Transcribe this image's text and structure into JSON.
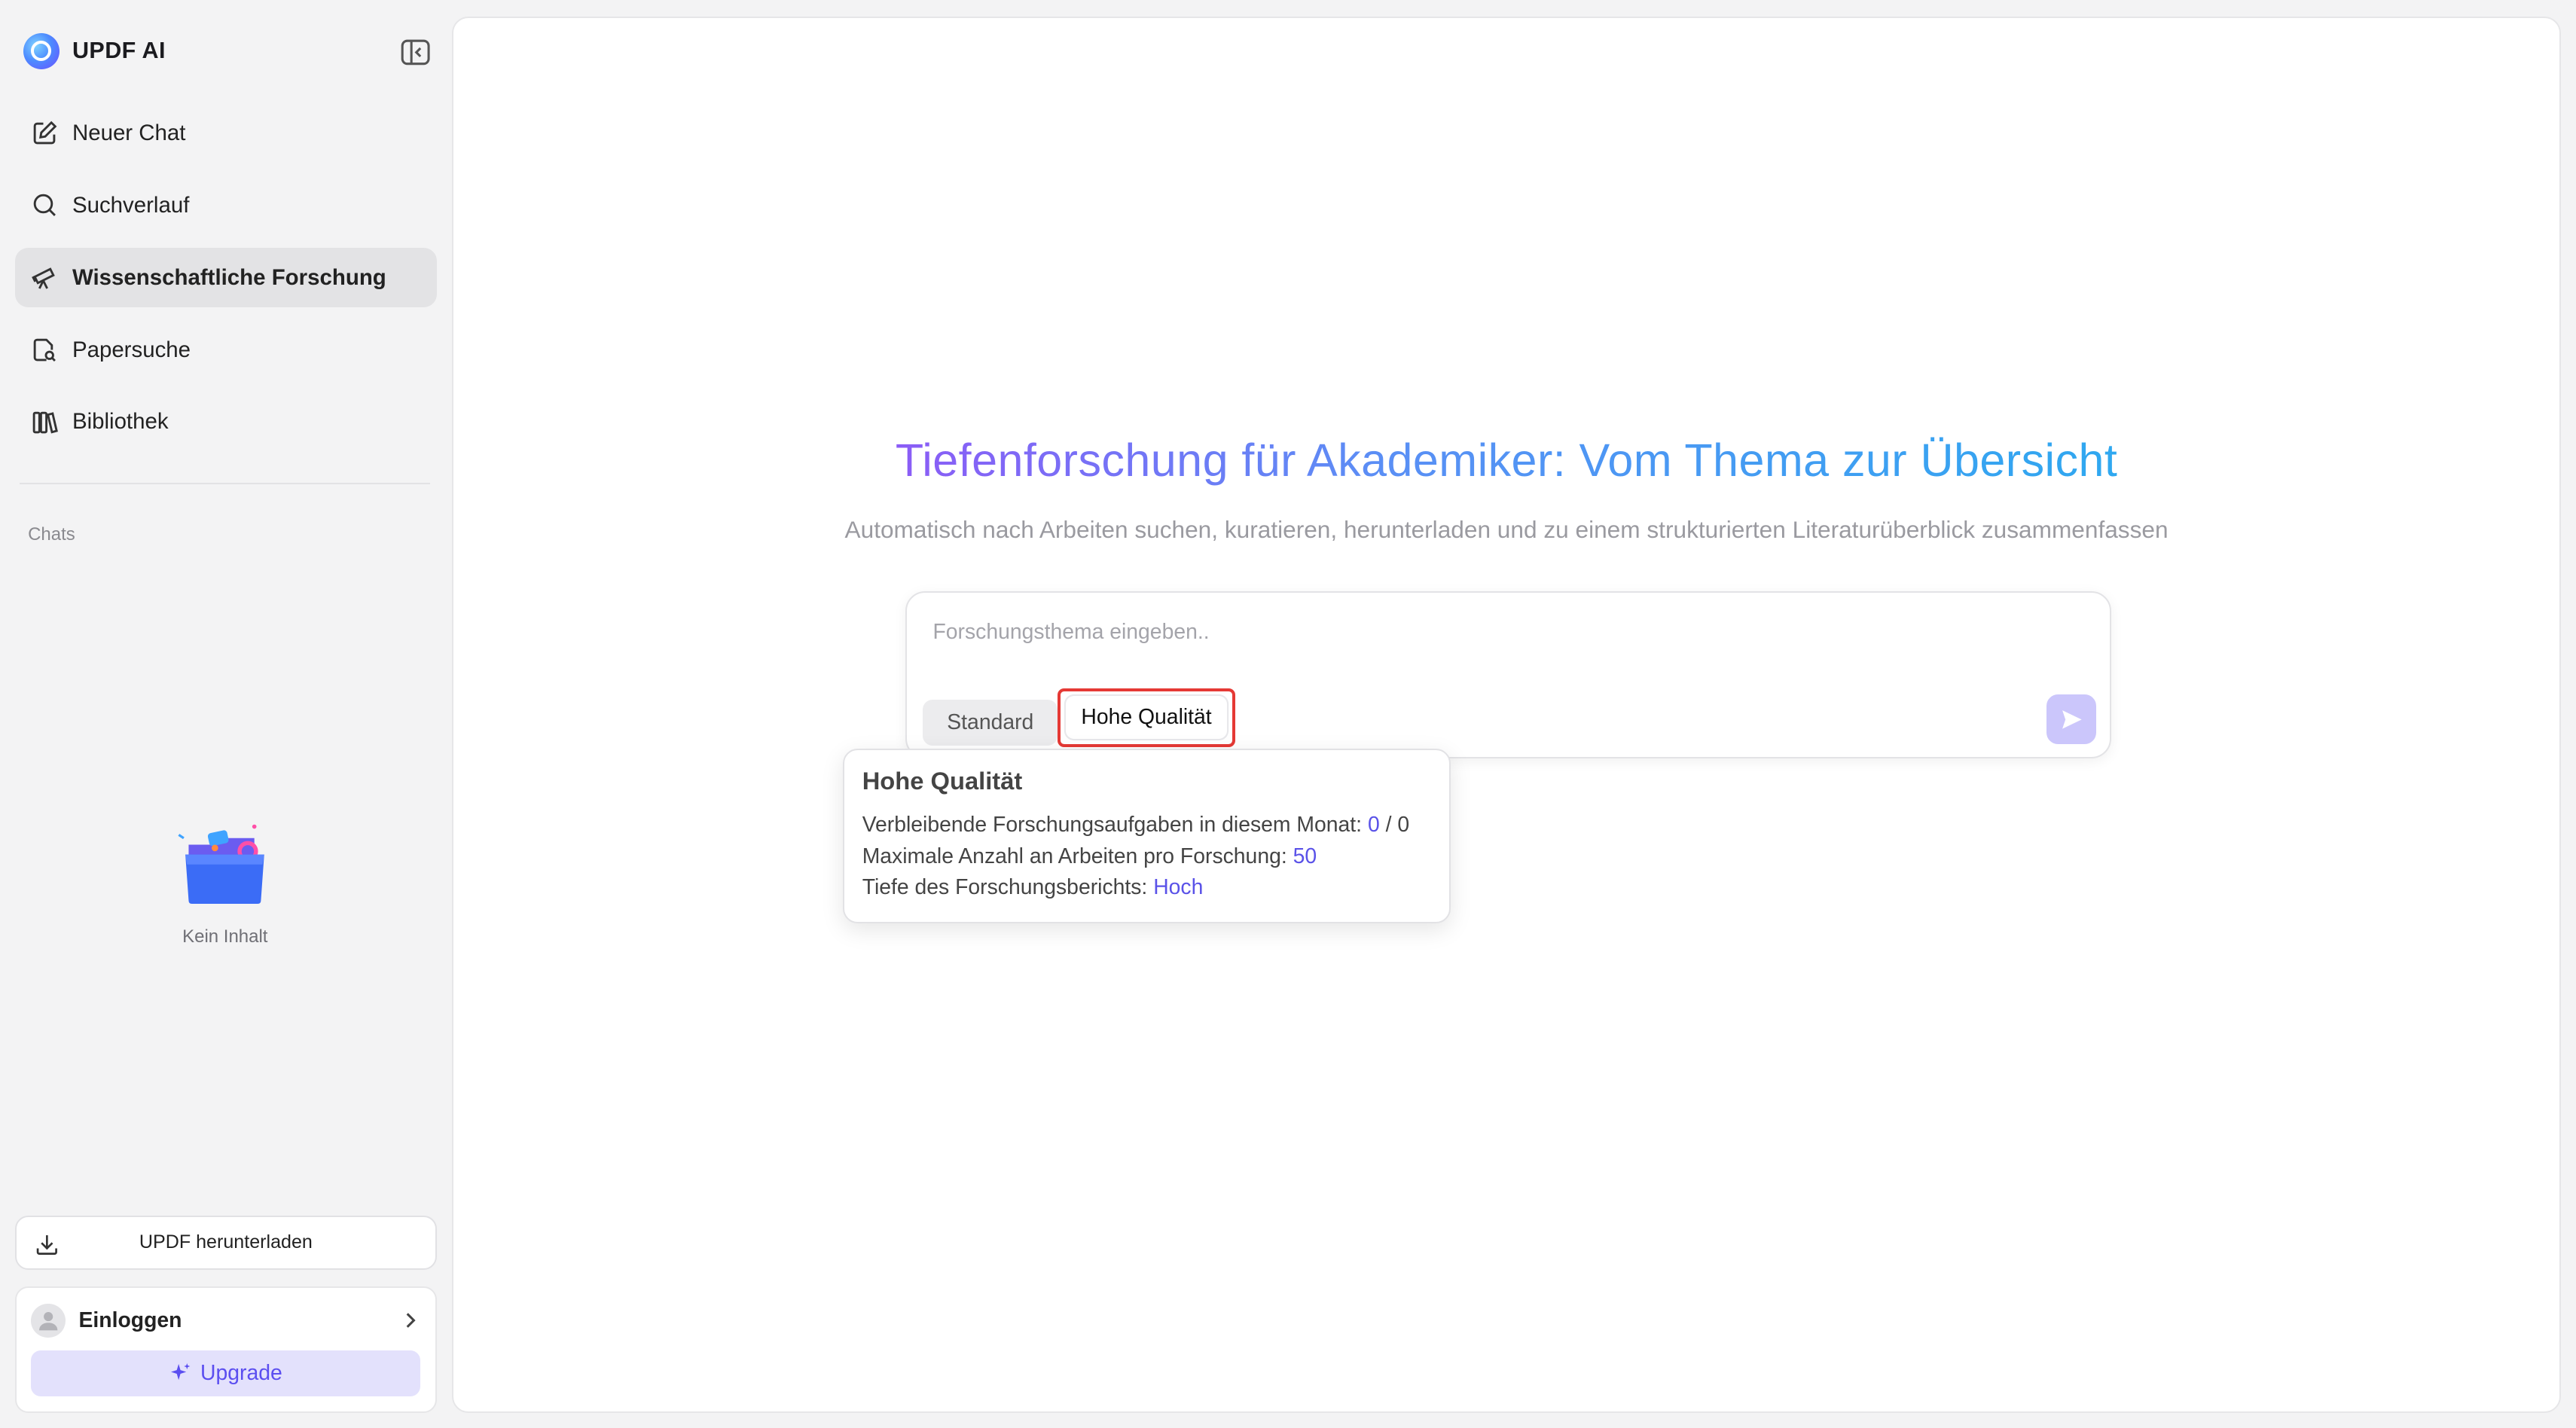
{
  "app": {
    "name": "UPDF AI"
  },
  "sidebar": {
    "nav": [
      {
        "label": "Neuer Chat",
        "icon": "edit-icon"
      },
      {
        "label": "Suchverlauf",
        "icon": "search-icon"
      },
      {
        "label": "Wissenschaftliche Forschung",
        "icon": "telescope-icon",
        "active": true
      },
      {
        "label": "Papersuche",
        "icon": "document-search-icon"
      },
      {
        "label": "Bibliothek",
        "icon": "library-icon"
      }
    ],
    "chats_label": "Chats",
    "empty_text": "Kein Inhalt",
    "download_label": "UPDF herunterladen",
    "login_label": "Einloggen",
    "upgrade_label": "Upgrade"
  },
  "main": {
    "title": "Tiefenforschung für Akademiker: Vom Thema zur Übersicht",
    "subtitle": "Automatisch nach Arbeiten suchen, kuratieren, herunterladen und zu einem strukturierten Literaturüberblick zusammenfassen",
    "input_placeholder": "Forschungsthema eingeben..",
    "modes": {
      "standard": "Standard",
      "high": "Hohe Qualität",
      "selected": "high"
    }
  },
  "tooltip": {
    "title": "Hohe Qualität",
    "remaining_label": "Verbleibende Forschungsaufgaben in diesem Monat:",
    "remaining_used": "0",
    "remaining_sep": "/",
    "remaining_total": "0",
    "max_papers_label": "Maximale Anzahl an Arbeiten pro Forschung:",
    "max_papers_value": "50",
    "depth_label": "Tiefe des Forschungsberichts:",
    "depth_value": "Hoch"
  },
  "colors": {
    "accent": "#5b4ef0",
    "highlight_border": "#e53935",
    "title_gradient_start": "#8b5cf6",
    "title_gradient_end": "#2fa8f0"
  }
}
